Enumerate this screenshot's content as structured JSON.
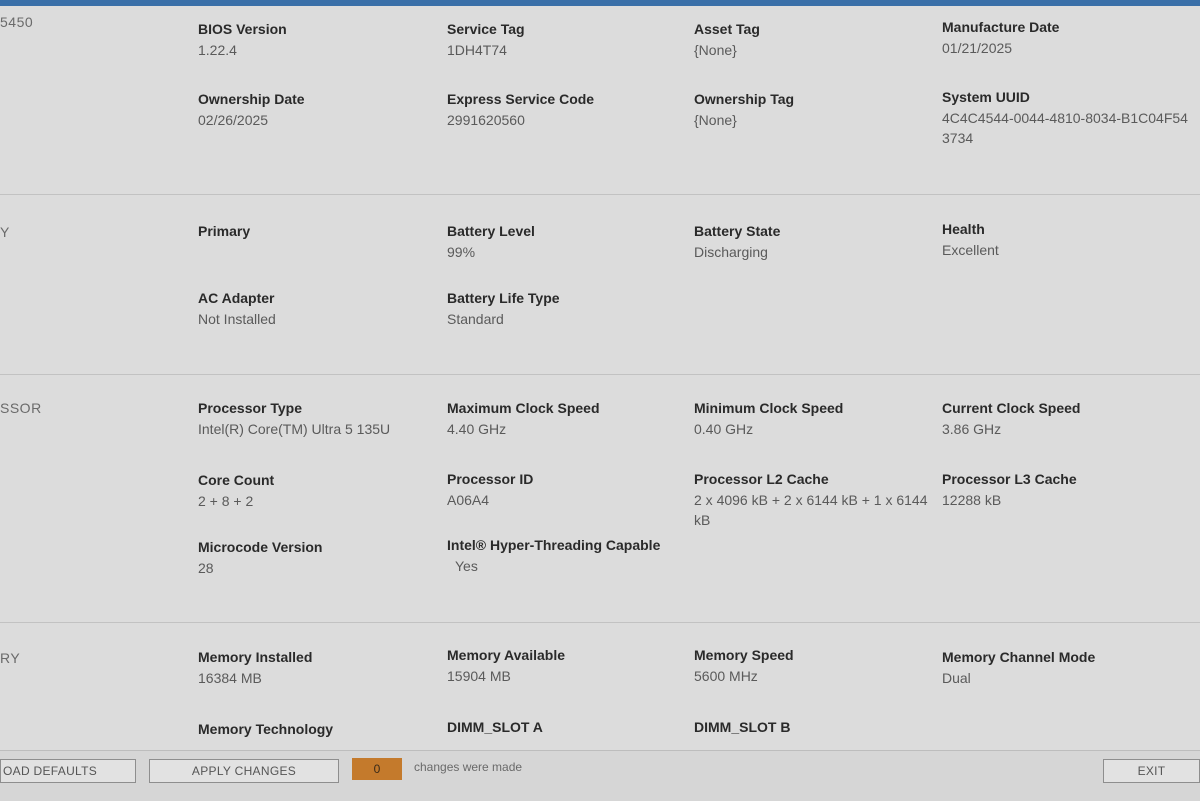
{
  "system": {
    "section_label": "5450",
    "fields": [
      {
        "label": "BIOS Version",
        "value": "1.22.4"
      },
      {
        "label": "Service Tag",
        "value": "1DH4T74"
      },
      {
        "label": "Asset Tag",
        "value": "{None}"
      },
      {
        "label": "Manufacture Date",
        "value": "01/21/2025"
      },
      {
        "label": "Ownership Date",
        "value": "02/26/2025"
      },
      {
        "label": "Express Service Code",
        "value": "2991620560"
      },
      {
        "label": "Ownership Tag",
        "value": "{None}"
      },
      {
        "label": "System UUID",
        "value": "4C4C4544-0044-4810-8034-B1C04F54",
        "value2": "3734"
      }
    ]
  },
  "battery": {
    "section_label": "Y",
    "fields": [
      {
        "label": "Primary",
        "value": ""
      },
      {
        "label": "Battery Level",
        "value": "99%"
      },
      {
        "label": "Battery State",
        "value": "Discharging"
      },
      {
        "label": "Health",
        "value": "Excellent"
      },
      {
        "label": "AC Adapter",
        "value": "Not Installed"
      },
      {
        "label": "Battery Life Type",
        "value": "Standard"
      }
    ]
  },
  "processor": {
    "section_label": "SSOR",
    "fields": [
      {
        "label": "Processor Type",
        "value": "Intel(R) Core(TM) Ultra 5 135U"
      },
      {
        "label": "Maximum Clock Speed",
        "value": "4.40 GHz"
      },
      {
        "label": "Minimum Clock Speed",
        "value": "0.40 GHz"
      },
      {
        "label": "Current Clock Speed",
        "value": "3.86 GHz"
      },
      {
        "label": "Core Count",
        "value": "2 + 8 + 2"
      },
      {
        "label": "Processor ID",
        "value": "A06A4"
      },
      {
        "label": "Processor L2 Cache",
        "value": "2 x 4096  kB + 2 x 6144  kB + 1 x 6144",
        "value2": "kB"
      },
      {
        "label": "Processor L3 Cache",
        "value": "12288 kB"
      },
      {
        "label": "Microcode Version",
        "value": "28"
      },
      {
        "label": "Intel® Hyper-Threading Capable",
        "value": "Yes"
      }
    ]
  },
  "memory": {
    "section_label": "RY",
    "fields": [
      {
        "label": "Memory Installed",
        "value": "16384 MB"
      },
      {
        "label": "Memory Available",
        "value": "15904 MB"
      },
      {
        "label": "Memory Speed",
        "value": "5600 MHz"
      },
      {
        "label": "Memory Channel Mode",
        "value": "Dual"
      },
      {
        "label": "Memory Technology",
        "value": ""
      },
      {
        "label": "DIMM_SLOT A",
        "value": ""
      },
      {
        "label": "DIMM_SLOT B",
        "value": ""
      }
    ]
  },
  "footer": {
    "load_defaults_label": "OAD DEFAULTS",
    "apply_changes_label": "APPLY CHANGES",
    "changes_count": "0",
    "changes_text": "changes were made",
    "exit_label": "EXIT"
  },
  "colors": {
    "background": "#dcdcdc",
    "accent_blue": "#3a6fa8",
    "changes_badge": "#c47a2c"
  }
}
